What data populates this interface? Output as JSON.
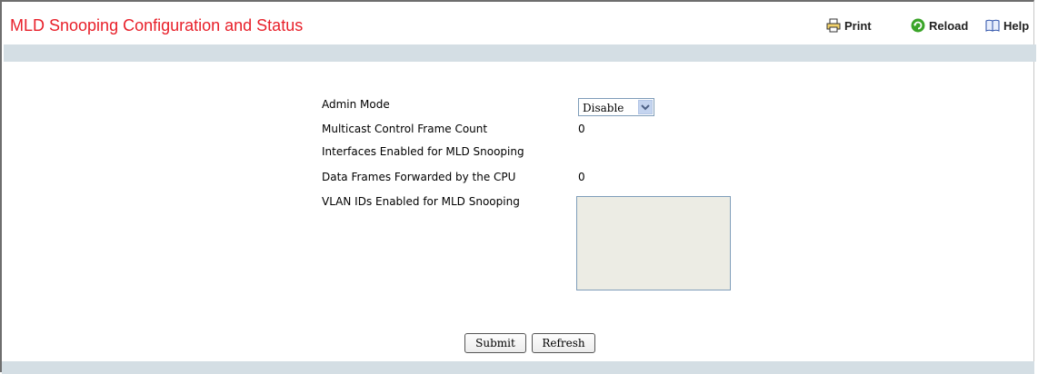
{
  "page": {
    "title": "MLD Snooping Configuration and Status"
  },
  "toolbar": {
    "print_label": "Print",
    "reload_label": "Reload",
    "help_label": "Help"
  },
  "form": {
    "admin_mode": {
      "label": "Admin Mode",
      "value": "Disable",
      "options": [
        "Disable"
      ]
    },
    "multicast_control_frame_count": {
      "label": "Multicast Control Frame Count",
      "value": "0"
    },
    "interfaces_enabled": {
      "label": "Interfaces Enabled for MLD Snooping",
      "value": ""
    },
    "data_frames_forwarded": {
      "label": "Data Frames Forwarded by the CPU",
      "value": "0"
    },
    "vlan_ids_enabled": {
      "label": "VLAN IDs Enabled for MLD Snooping",
      "items": []
    }
  },
  "buttons": {
    "submit_label": "Submit",
    "refresh_label": "Refresh"
  },
  "colors": {
    "title": "#e8202a",
    "band": "#d4dee4",
    "listbox_bg": "#ecece4"
  },
  "icons": {
    "print": "printer-icon",
    "reload": "reload-icon",
    "help": "help-book-icon",
    "dropdown": "chevron-down-icon"
  }
}
